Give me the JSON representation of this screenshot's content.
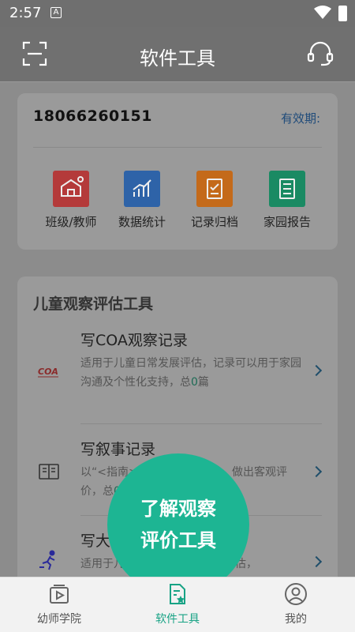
{
  "status": {
    "time": "2:57",
    "sim_label": "A"
  },
  "header": {
    "title": "软件工具"
  },
  "account": {
    "phone": "18066260151",
    "validity_label": "有效期:"
  },
  "functions": [
    {
      "label": "班级/教师",
      "color": "#b43a3a"
    },
    {
      "label": "数据统计",
      "color": "#2e63a8"
    },
    {
      "label": "记录归档",
      "color": "#c46a1a"
    },
    {
      "label": "家园报告",
      "color": "#1a8a63"
    }
  ],
  "tools": {
    "section_title": "儿童观察评估工具",
    "items": [
      {
        "name": "写COA观察记录",
        "desc_a": "适用于儿童日常发展评估，记录可以用于家园沟通及个性化支持，总",
        "count": "0",
        "desc_b": "篇"
      },
      {
        "name": "写叙事记录",
        "desc_a": "以“<指南>”为依据评估体系，做出客观评价，总",
        "count": "0",
        "desc_b": "篇"
      },
      {
        "name": "写大动作记录",
        "desc_a": "适用于儿童户外运动的观察和评估，",
        "count": "",
        "desc_b": ""
      }
    ]
  },
  "overlay": {
    "line1": "了解观察",
    "line2": "评价工具"
  },
  "tabs": [
    {
      "label": "幼师学院"
    },
    {
      "label": "软件工具"
    },
    {
      "label": "我的"
    }
  ],
  "colors": {
    "accent": "#1db593",
    "tab_active": "#18a385"
  }
}
